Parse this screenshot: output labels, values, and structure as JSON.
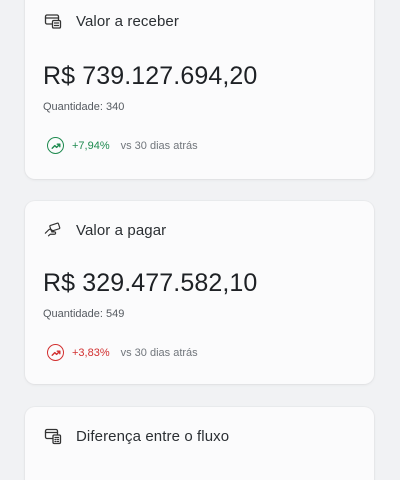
{
  "cards": [
    {
      "title": "Valor a receber",
      "icon": "money-receive-icon",
      "amount": "R$ 739.127.694,20",
      "quantity": "Quantidade: 340",
      "change": "+7,94%",
      "change_direction": "up",
      "change_color": "#1e8a4f",
      "since": "vs 30 dias atrás"
    },
    {
      "title": "Valor a pagar",
      "icon": "hand-payment-icon",
      "amount": "R$ 329.477.582,10",
      "quantity": "Quantidade: 549",
      "change": "+3,83%",
      "change_direction": "up",
      "change_color": "#d22f2f",
      "since": "vs 30 dias atrás"
    },
    {
      "title": "Diferença entre o fluxo",
      "icon": "cash-flow-icon"
    }
  ]
}
